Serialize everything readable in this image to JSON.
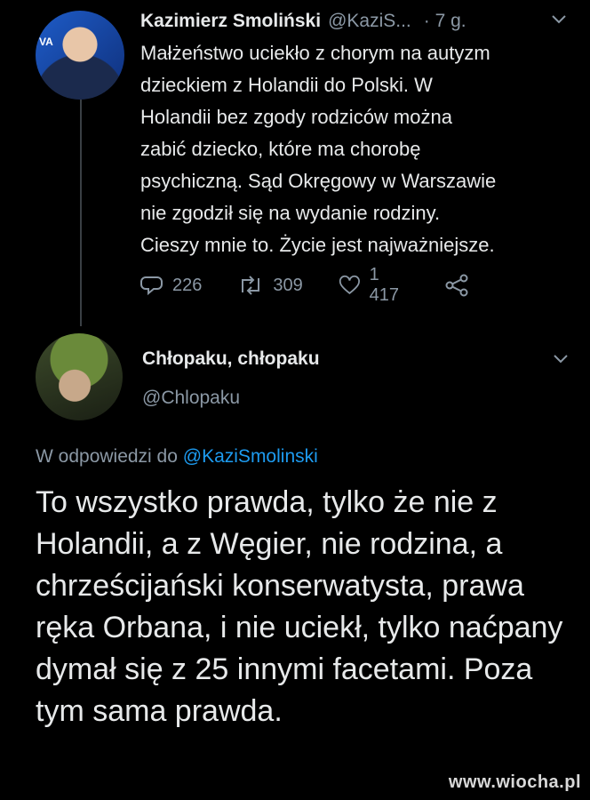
{
  "tweet": {
    "author_name": "Kazimierz Smoliński",
    "author_handle": "@KaziS...",
    "time": "· 7 g.",
    "avatar_badge": "VA",
    "text": "Małżeństwo uciekło z chorym na autyzm\ndzieckiem z Holandii do Polski. W\nHolandii bez zgody rodziców można\nzabić dziecko, które ma chorobę\npsychiczną. Sąd Okręgowy w Warszawie\nnie zgodził się na wydanie rodziny.\nCieszy mnie to. Życie jest najważniejsze.",
    "replies": "226",
    "retweets": "309",
    "likes": "1 417",
    "icons": [
      "reply-icon",
      "retweet-icon",
      "like-icon",
      "share-icon",
      "chevron-down-icon"
    ]
  },
  "reply": {
    "author_name": "Chłopaku, chłopaku",
    "author_handle": "@Chlopaku",
    "replying_prefix": "W odpowiedzi do",
    "replying_to": "@KaziSmolinski",
    "text": "To wszystko prawda, tylko że nie z Holandii, a z Węgier, nie rodzina, a chrześcijański konserwatysta, prawa ręka Orbana, i nie uciekł, tylko naćpany dymał się z 25 innymi facetami. Poza tym sama prawda."
  },
  "watermark": "www.wiocha.pl",
  "colors": {
    "background": "#000000",
    "text": "#e7e9ea",
    "secondary": "#8b98a5",
    "link": "#1d9bf0"
  }
}
